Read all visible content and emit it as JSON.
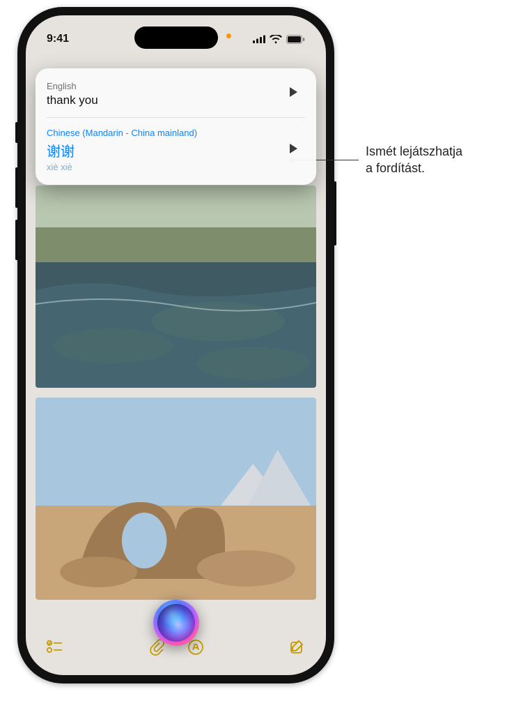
{
  "status": {
    "time": "9:41"
  },
  "siri_card": {
    "source": {
      "language": "English",
      "text": "thank you"
    },
    "target": {
      "language": "Chinese (Mandarin - China mainland)",
      "text": "谢谢",
      "romanization": "xiè xiè"
    }
  },
  "toolbar": {
    "icons": {
      "checklist": "checklist-icon",
      "attach": "attach-icon",
      "markup": "markup-icon",
      "compose": "compose-icon"
    }
  },
  "callout": {
    "line1": "Ismét lejátszhatja",
    "line2": "a fordítást."
  }
}
